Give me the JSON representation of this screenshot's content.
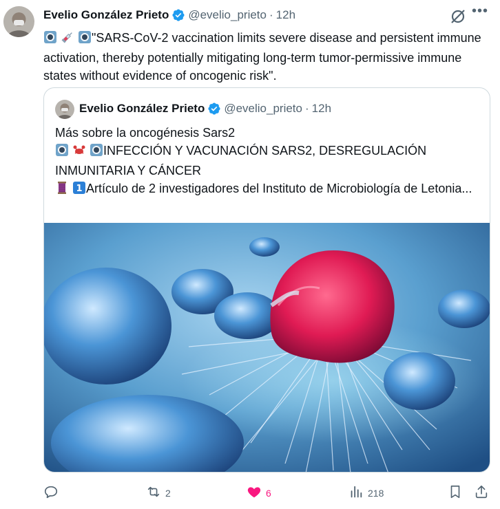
{
  "post": {
    "author_name": "Evelio González Prieto",
    "handle": "@evelio_prieto",
    "separator": "·",
    "time": "12h",
    "text": "\"SARS-CoV-2 vaccination limits severe disease and persistent immune activation, thereby potentially mitigating long-term tumor-permissive immune states without evidence of oncogenic risk\"."
  },
  "quote": {
    "author_name": "Evelio González Prieto",
    "handle": "@evelio_prieto",
    "separator": "·",
    "time": "12h",
    "line1": "Más sobre la oncogénesis Sars2",
    "line2": "INFECCIÓN Y VACUNACIÓN SARS2, DESREGULACIÓN INMUNITARIA Y CÁNCER",
    "line3": "Artículo de 2 investigadores del Instituto de Microbiología de Letonia..."
  },
  "actions": {
    "reply_count": "",
    "repost_count": "2",
    "like_count": "6",
    "views_count": "218"
  },
  "colors": {
    "verified": "#1d9bf0",
    "like": "#f91880",
    "muted": "#536471",
    "border": "#cfd9de"
  },
  "icons": [
    "verified-badge-icon",
    "grok-icon",
    "more-icon",
    "reply-icon",
    "repost-icon",
    "like-icon",
    "views-icon",
    "bookmark-icon",
    "share-icon"
  ]
}
